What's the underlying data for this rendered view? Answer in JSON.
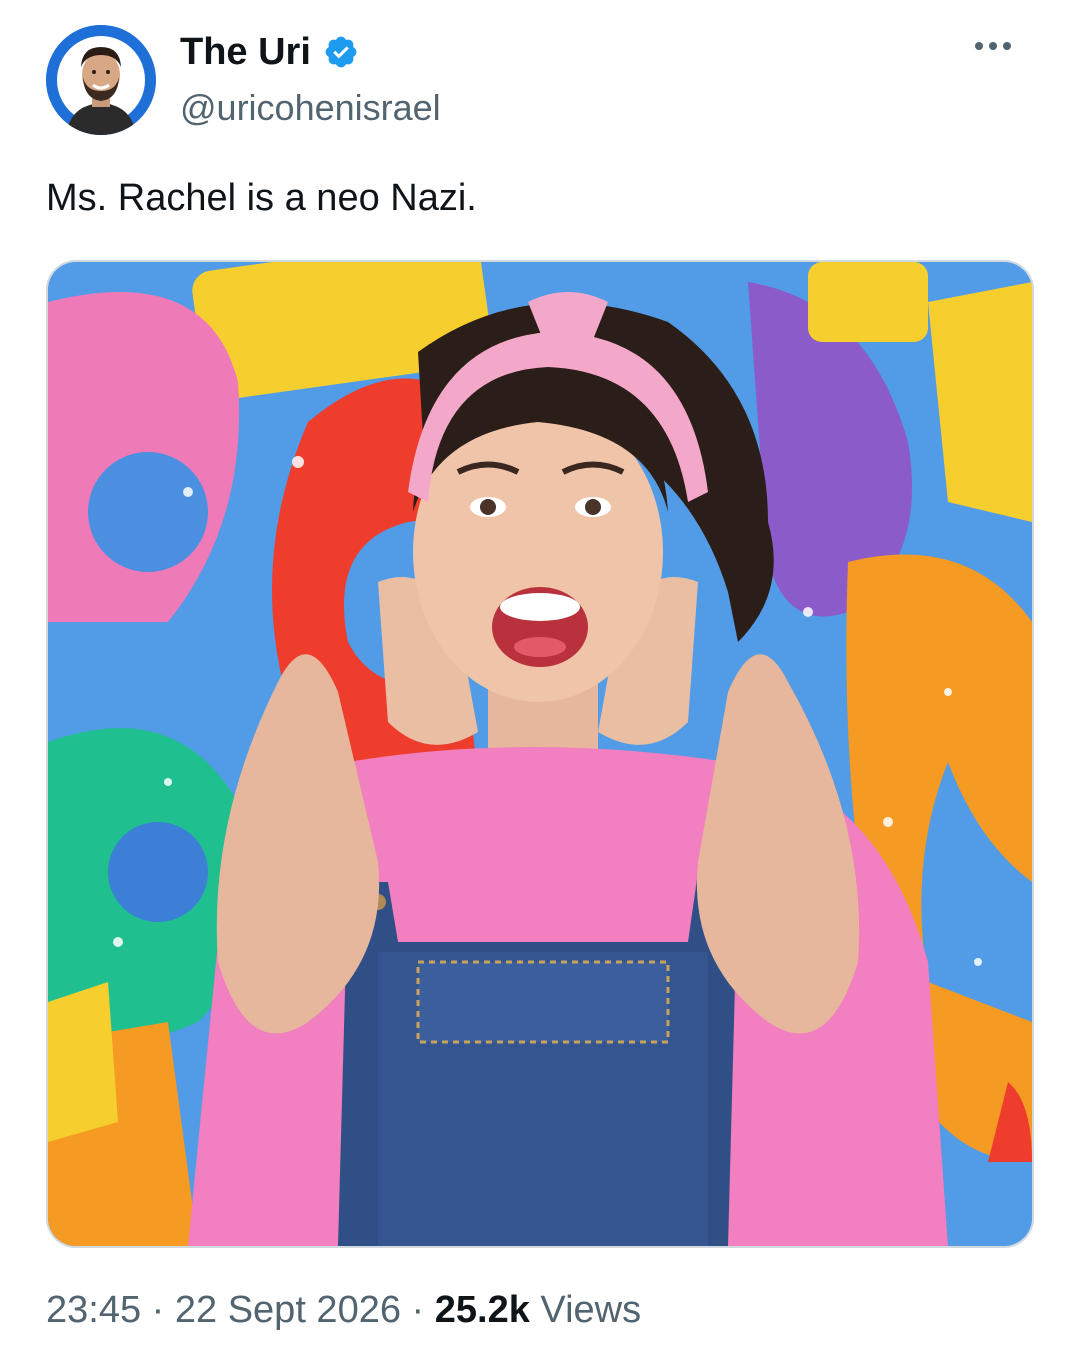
{
  "author": {
    "display_name": "The Uri",
    "handle": "@uricohenisrael",
    "verified": true,
    "avatar_icon": "user-avatar"
  },
  "tweet": {
    "text": "Ms. Rachel is a neo Nazi.",
    "media": {
      "type": "photo"
    }
  },
  "meta": {
    "time": "23:45",
    "separator": "·",
    "date": "22 Sept 2026",
    "views_count": "25.2k",
    "views_label": "Views"
  },
  "icons": {
    "more": "more-horizontal-icon",
    "verified": "verified-badge-icon"
  },
  "colors": {
    "verified_blue": "#1d9bf0",
    "secondary_text": "#536471",
    "primary_text": "#0f1419"
  }
}
